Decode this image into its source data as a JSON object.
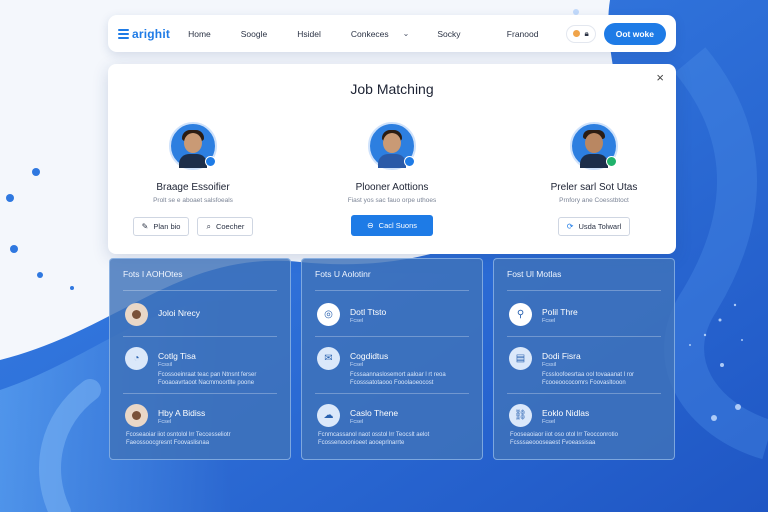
{
  "navbar": {
    "logo": "arighit",
    "links": [
      "Home",
      "Soogle",
      "Hsidel",
      "Conkeces",
      "Socky"
    ],
    "right_link": "Franood",
    "cta": "Oot woke",
    "icons": [
      "user-dot-icon",
      "lock-icon"
    ]
  },
  "modal": {
    "title": "Job Matching",
    "close": "×",
    "candidates": [
      {
        "name": "Braage Essoifier",
        "subtitle": "Prolt se e aboaet salsfoeals",
        "buttons": [
          {
            "icon": "edit-icon",
            "label": "Plan bio"
          },
          {
            "icon": "search-icon",
            "label": "Coecher"
          }
        ]
      },
      {
        "name": "Plooner Aottions",
        "subtitle": "Fiast yos sac fauo orpe uthoes",
        "buttons": [
          {
            "icon": "badge-icon",
            "label": "Cacl Suons",
            "primary": true
          }
        ]
      },
      {
        "name": "Preler sarl Sot Utas",
        "subtitle": "Prnfory ane Coesstbtoct",
        "buttons": [
          {
            "icon": "refresh-icon",
            "label": "Usda Tolwarl"
          }
        ]
      }
    ]
  },
  "panels": [
    {
      "title": "Fots I AOHOtes",
      "items": [
        {
          "icon": "photo",
          "title": "Joloi Nrecy",
          "subtitle": "",
          "desc": []
        },
        {
          "icon": "chart-icon",
          "title": "Cotlg Tisa",
          "subtitle": "Fcssil",
          "desc": [
            "Fcossoeinraat teac pan Ntnsnt ferser",
            "Fooaoavrtaoot Nacmmoortlte poone"
          ]
        },
        {
          "icon": "photo",
          "title": "Hby A Bidiss",
          "subtitle": "Fcsel",
          "desc": [
            "Fcoseaoiar iiot osntolol lrr Teccesseliotr",
            "Faeossoocgresnt Foovaslisnaa"
          ]
        }
      ]
    },
    {
      "title": "Fots U Aolotinr",
      "items": [
        {
          "icon": "target-icon",
          "title": "Dotl Ttsto",
          "subtitle": "Fcsel",
          "desc": []
        },
        {
          "icon": "chat-icon",
          "title": "Cogdidtus",
          "subtitle": "Fcsel",
          "desc": [
            "Fcssaannaslosemort aaloar l rt reoa",
            "Fcosssatotaooo Fooolaoeocost"
          ]
        },
        {
          "icon": "cloud-icon",
          "title": "Caslo Thene",
          "subtitle": "Fcsel",
          "desc": [
            "Fcnmcassanol naot osstol lrr Teocslt aelot",
            "Fcossenooonioeet aooeprlnarrte"
          ]
        }
      ]
    },
    {
      "title": "Fost Ul Motlas",
      "items": [
        {
          "icon": "pin-icon",
          "title": "Polil Thre",
          "subtitle": "Fcsel",
          "desc": []
        },
        {
          "icon": "card-icon",
          "title": "Dodi Fisra",
          "subtitle": "Fcssil",
          "desc": [
            "Fcssloofoesrtaa ool tovaaanat l ror",
            "Fcooeoococomrs Foovasltooon"
          ]
        },
        {
          "icon": "link-icon",
          "title": "Eoklo Nidlas",
          "subtitle": "Fcsel",
          "desc": [
            "Fooseaoiaor iiot oso otol lrr Teocconrotio",
            "Fcsssaeoooseaest Fvoeassisaa"
          ]
        }
      ]
    }
  ],
  "colors": {
    "accent": "#1e7be6",
    "panel": "#3f73b9",
    "wave": "#2f6fd6"
  }
}
